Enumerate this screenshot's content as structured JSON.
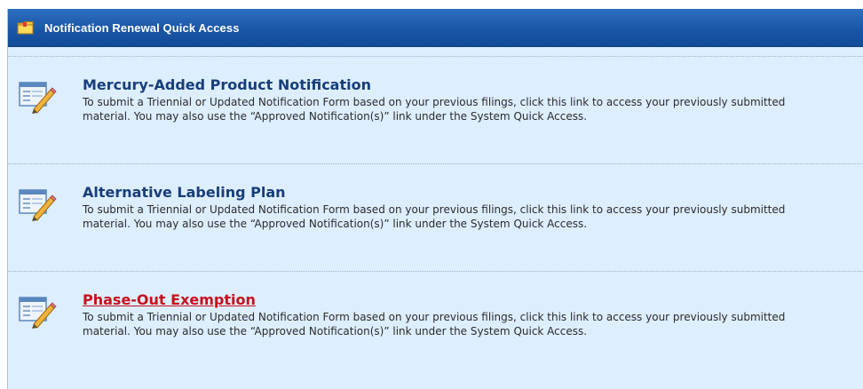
{
  "header": {
    "title": "Notification Renewal Quick Access",
    "icon": "folder-icon"
  },
  "items": [
    {
      "title": "Mercury-Added Product Notification",
      "description": "To submit a Triennial or Updated Notification Form based on your previous filings, click this link to access your previously submitted material. You may also use the “Approved Notification(s)” link under the System Quick Access.",
      "icon": "edit-form-icon",
      "active": false
    },
    {
      "title": "Alternative Labeling Plan",
      "description": "To submit a Triennial or Updated Notification Form based on your previous filings, click this link to access your previously submitted material. You may also use the “Approved Notification(s)” link under the System Quick Access.",
      "icon": "edit-form-icon",
      "active": false
    },
    {
      "title": "Phase-Out Exemption",
      "description": "To submit a Triennial or Updated Notification Form based on your previous filings, click this link to access your previously submitted material. You may also use the “Approved Notification(s)” link under the System Quick Access.",
      "icon": "edit-form-icon",
      "active": true
    }
  ],
  "colors": {
    "header_bg": "#1a56a6",
    "panel_bg": "#ddeeff",
    "link": "#173e7a",
    "link_active": "#c8101a"
  }
}
